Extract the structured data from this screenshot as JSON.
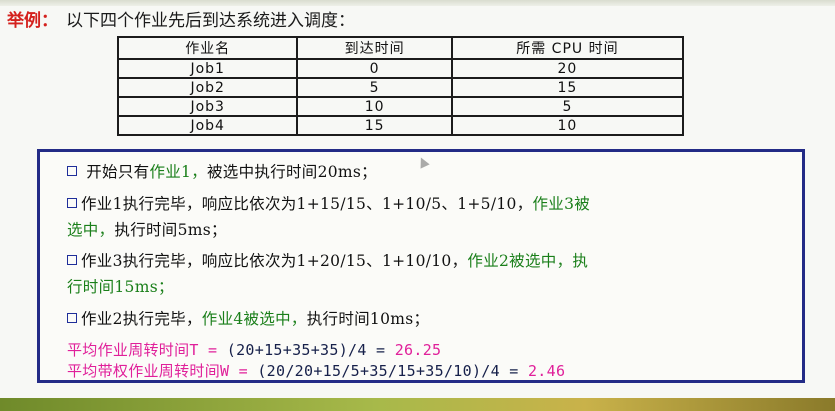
{
  "heading": {
    "label": "举例：",
    "text": "以下四个作业先后到达系统进入调度："
  },
  "table": {
    "headers": [
      "作业名",
      "到达时间",
      "所需 CPU 时间"
    ],
    "rows": [
      [
        "Job1",
        "0",
        "20"
      ],
      [
        "Job2",
        "5",
        "15"
      ],
      [
        "Job3",
        "10",
        "5"
      ],
      [
        "Job4",
        "15",
        "10"
      ]
    ]
  },
  "steps": {
    "s1": {
      "black": "开始只有",
      "green1": "作业1，",
      "black2": "被选中执行时间20ms；"
    },
    "s2": {
      "line1_black": "作业1执行完毕，响应比依次为1+15/15、1+10/5、1+5/10，",
      "line1_green": "作业3被",
      "line2_green": "选中，",
      "line2_black": "执行时间5ms；"
    },
    "s3": {
      "line1_black": "作业3执行完毕，响应比依次为1+20/15、1+10/10，",
      "line1_green": "作业2被选中，执",
      "line2_green": "行时间15ms；"
    },
    "s4": {
      "black": "作业2执行完毕，",
      "green": "作业4被选中，",
      "black2": "执行时间10ms；"
    }
  },
  "summary": {
    "t_label": "平均作业周转时间T =",
    "t_formula": "(20+15+35+35)/4 =",
    "t_value": "26.25",
    "w_label": "平均带权作业周转时间W =",
    "w_formula": "(20/20+15/5+35/15+35/10)/4 =",
    "w_value": "2.46"
  }
}
